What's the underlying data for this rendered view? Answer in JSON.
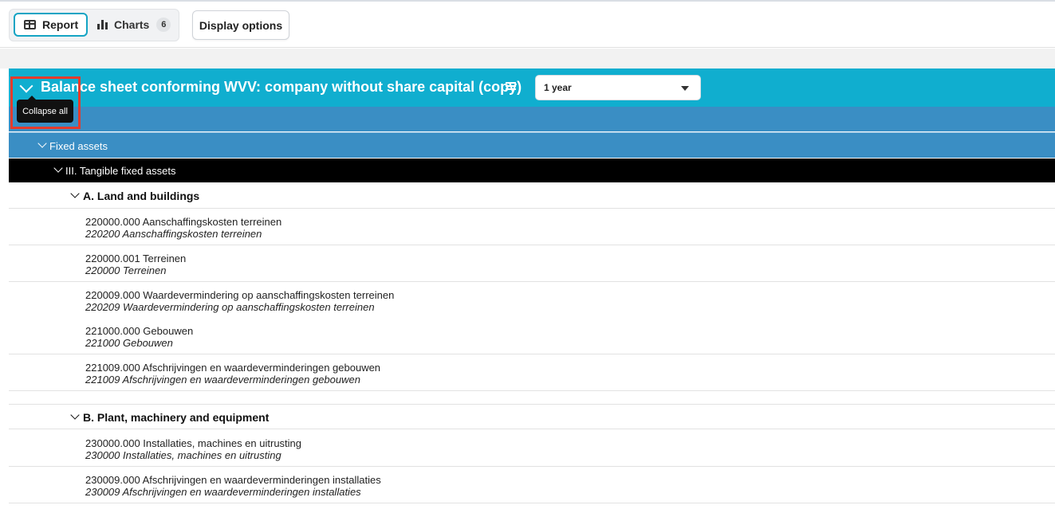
{
  "toolbar": {
    "report_label": "Report",
    "charts_label": "Charts",
    "charts_count": "6",
    "display_options_label": "Display options"
  },
  "report": {
    "title": "Balance sheet conforming WVV: company without share capital (copy)",
    "period": "1 year",
    "tooltip": "Collapse all"
  },
  "tree": {
    "level2_label": "Fixed assets",
    "level3_label": "III. Tangible fixed assets",
    "groups": [
      {
        "label": "A. Land and buildings",
        "accounts": [
          {
            "line1": "220000.000 Aanschaffingskosten terreinen",
            "line2": "220200 Aanschaffingskosten terreinen"
          },
          {
            "line1": "220000.001 Terreinen",
            "line2": "220000 Terreinen"
          },
          {
            "line1": "220009.000 Waardevermindering op aanschaffingskosten terreinen",
            "line2": "220209 Waardevermindering op aanschaffingskosten terreinen"
          },
          {
            "line1": "221000.000 Gebouwen",
            "line2": "221000 Gebouwen"
          },
          {
            "line1": "221009.000 Afschrijvingen en waardeverminderingen gebouwen",
            "line2": "221009 Afschrijvingen en waardeverminderingen gebouwen"
          }
        ]
      },
      {
        "label": "B. Plant, machinery and equipment",
        "accounts": [
          {
            "line1": "230000.000 Installaties, machines en uitrusting",
            "line2": "230000 Installaties, machines en uitrusting"
          },
          {
            "line1": "230009.000 Afschrijvingen en waardeverminderingen installaties",
            "line2": "230009 Afschrijvingen en waardeverminderingen installaties"
          }
        ]
      }
    ]
  },
  "colors": {
    "header": "#10aecf",
    "level_blue": "#3a8ec4",
    "level_black": "#000000",
    "highlight": "#e53b2c"
  }
}
